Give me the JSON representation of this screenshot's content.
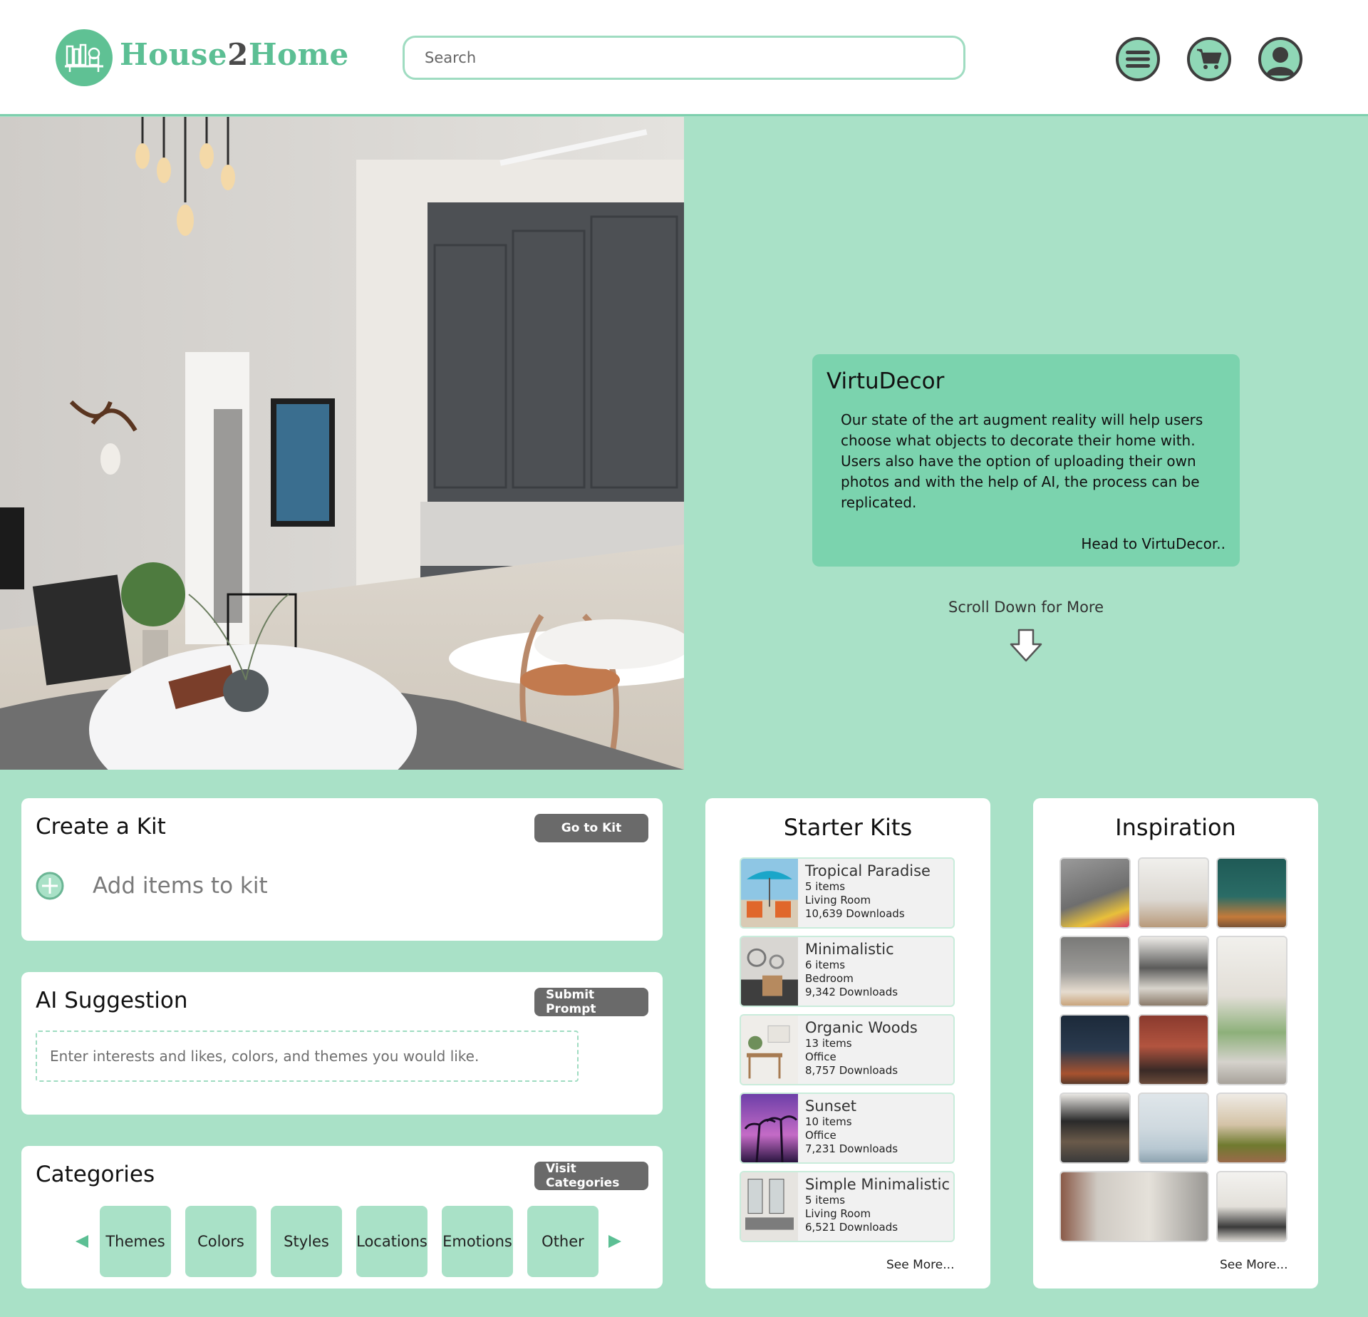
{
  "header": {
    "brand_name": "House2Home",
    "search_placeholder": "Search",
    "icons": [
      "menu-icon",
      "cart-icon",
      "account-icon"
    ]
  },
  "hero": {
    "image": "living-room-kitchen-photo",
    "virtudecor": {
      "title": "VirtuDecor",
      "body": "Our state of the art augment reality will help users choose what objects to decorate their home with. Users also have the option of uploading their own photos and with the help of AI, the process can be replicated.",
      "link": "Head to VirtuDecor.."
    },
    "scroll_text": "Scroll Down for More"
  },
  "create_kit": {
    "title": "Create a Kit",
    "button": "Go to Kit",
    "add_label": "Add items to kit"
  },
  "ai_suggestion": {
    "title": "AI Suggestion",
    "button": "Submit Prompt",
    "placeholder": "Enter interests and likes, colors, and themes you would like."
  },
  "categories": {
    "title": "Categories",
    "button": "Visit Categories",
    "items": [
      "Themes",
      "Colors",
      "Styles",
      "Locations",
      "Emotions",
      "Other"
    ]
  },
  "starter_kits": {
    "title": "Starter Kits",
    "see_more": "See More...",
    "kits": [
      {
        "name": "Tropical Paradise",
        "items": "5 items",
        "room": "Living Room",
        "downloads": "10,639 Downloads"
      },
      {
        "name": "Minimalistic",
        "items": "6 items",
        "room": "Bedroom",
        "downloads": "9,342 Downloads"
      },
      {
        "name": "Organic Woods",
        "items": "13 items",
        "room": "Office",
        "downloads": "8,757 Downloads"
      },
      {
        "name": "Sunset",
        "items": "10 items",
        "room": "Office",
        "downloads": "7,231 Downloads"
      },
      {
        "name": "Simple Minimalistic",
        "items": "5 items",
        "room": "Living Room",
        "downloads": "6,521 Downloads"
      }
    ]
  },
  "inspiration": {
    "title": "Inspiration",
    "see_more": "See More..."
  },
  "colors": {
    "accent": "#a9e1c7",
    "card_green": "#7bd3ae",
    "logo_green": "#5cbf94",
    "dark_button": "#6a6a6a"
  }
}
